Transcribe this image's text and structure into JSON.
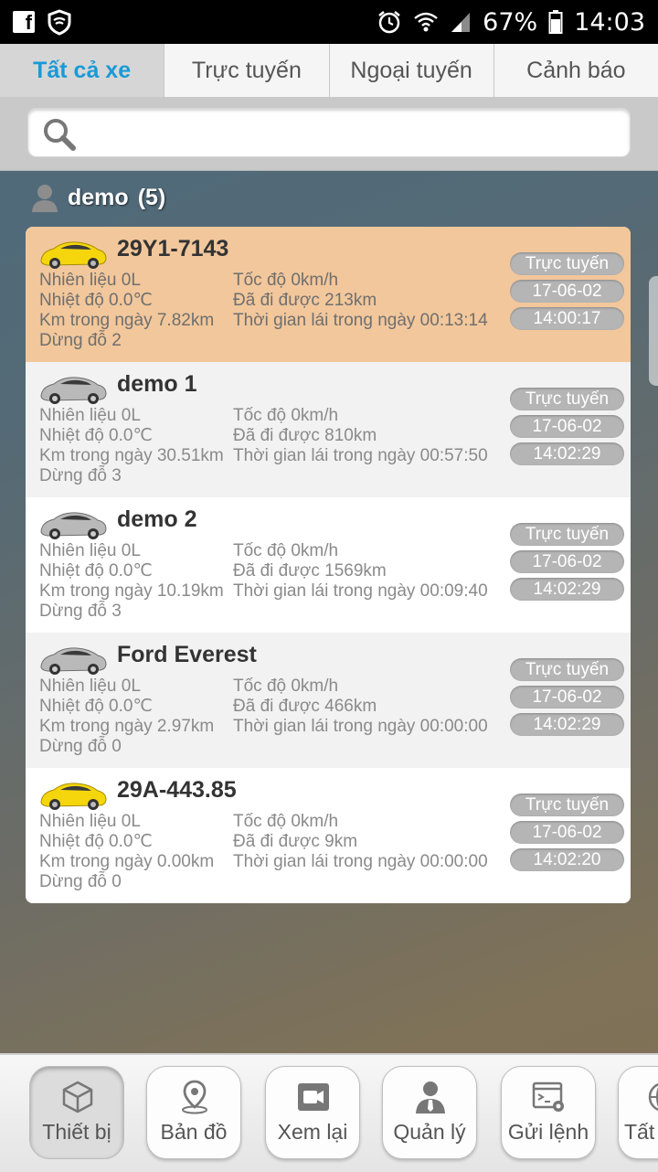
{
  "status_bar": {
    "battery": "67%",
    "time": "14:03"
  },
  "tabs": [
    {
      "label": "Tất cả xe",
      "active": true
    },
    {
      "label": "Trực tuyến",
      "active": false
    },
    {
      "label": "Ngoại tuyến",
      "active": false
    },
    {
      "label": "Cảnh báo",
      "active": false
    }
  ],
  "search": {
    "placeholder": ""
  },
  "group": {
    "name": "demo",
    "count": "(5)"
  },
  "vehicles": [
    {
      "name": "29Y1-7143",
      "car_color": "yellow",
      "fuel": "Nhiên liệu 0L",
      "temp": "Nhiệt độ 0.0℃",
      "km_day": "Km trong ngày 7.82km",
      "stops": "Dừng đỗ 2",
      "speed": "Tốc độ 0km/h",
      "distance": "Đã đi được 213km",
      "drive_time": "Thời gian lái trong ngày 00:13:14",
      "status": "Trực tuyến",
      "date": "17-06-02",
      "time": "14:00:17"
    },
    {
      "name": "demo 1",
      "car_color": "silver",
      "fuel": "Nhiên liệu 0L",
      "temp": "Nhiệt độ 0.0℃",
      "km_day": "Km trong ngày 30.51km",
      "stops": "Dừng đỗ 3",
      "speed": "Tốc độ 0km/h",
      "distance": "Đã đi được 810km",
      "drive_time": "Thời gian lái trong ngày 00:57:50",
      "status": "Trực tuyến",
      "date": "17-06-02",
      "time": "14:02:29"
    },
    {
      "name": "demo 2",
      "car_color": "silver",
      "fuel": "Nhiên liệu 0L",
      "temp": "Nhiệt độ 0.0℃",
      "km_day": "Km trong ngày 10.19km",
      "stops": "Dừng đỗ 3",
      "speed": "Tốc độ 0km/h",
      "distance": "Đã đi được 1569km",
      "drive_time": "Thời gian lái trong ngày 00:09:40",
      "status": "Trực tuyến",
      "date": "17-06-02",
      "time": "14:02:29"
    },
    {
      "name": "Ford Everest",
      "car_color": "silver",
      "fuel": "Nhiên liệu 0L",
      "temp": "Nhiệt độ 0.0℃",
      "km_day": "Km trong ngày 2.97km",
      "stops": "Dừng đỗ 0",
      "speed": "Tốc độ 0km/h",
      "distance": "Đã đi được 466km",
      "drive_time": "Thời gian lái trong ngày 00:00:00",
      "status": "Trực tuyến",
      "date": "17-06-02",
      "time": "14:02:29"
    },
    {
      "name": "29A-443.85",
      "car_color": "yellow",
      "fuel": "Nhiên liệu 0L",
      "temp": "Nhiệt độ 0.0℃",
      "km_day": "Km trong ngày 0.00km",
      "stops": "Dừng đỗ 0",
      "speed": "Tốc độ 0km/h",
      "distance": "Đã đi được 9km",
      "drive_time": "Thời gian lái trong ngày 00:00:00",
      "status": "Trực tuyến",
      "date": "17-06-02",
      "time": "14:02:20"
    }
  ],
  "bottom_nav": [
    {
      "label": "Thiết bị",
      "icon": "cube-icon",
      "active": true
    },
    {
      "label": "Bản đồ",
      "icon": "map-pin-icon",
      "active": false
    },
    {
      "label": "Xem lại",
      "icon": "video-icon",
      "active": false
    },
    {
      "label": "Quản lý",
      "icon": "manager-icon",
      "active": false
    },
    {
      "label": "Gửi lệnh",
      "icon": "send-command-icon",
      "active": false
    },
    {
      "label": "Tất",
      "icon": "globe-icon",
      "active": false
    }
  ],
  "colors": {
    "tab_active": "#1a9ad6",
    "highlight_row": "#f2c79b",
    "badge": "#b5b5b5",
    "car_yellow": "#f5d60c",
    "car_silver": "#b9b9b9"
  }
}
